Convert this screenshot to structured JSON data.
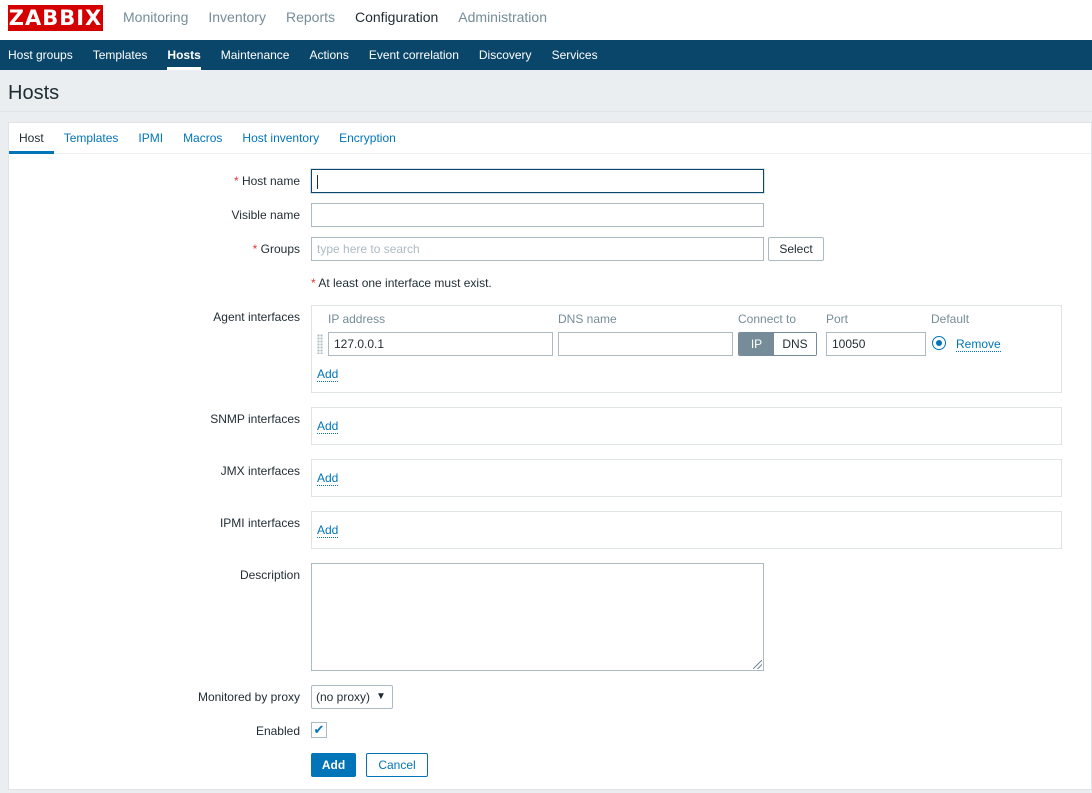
{
  "logo": "ZABBIX",
  "top_menu": [
    "Monitoring",
    "Inventory",
    "Reports",
    "Configuration",
    "Administration"
  ],
  "top_menu_active": "Configuration",
  "sub_menu": [
    "Host groups",
    "Templates",
    "Hosts",
    "Maintenance",
    "Actions",
    "Event correlation",
    "Discovery",
    "Services"
  ],
  "sub_menu_active": "Hosts",
  "page_title": "Hosts",
  "tabs": [
    "Host",
    "Templates",
    "IPMI",
    "Macros",
    "Host inventory",
    "Encryption"
  ],
  "tabs_active": "Host",
  "form": {
    "host_name_label": "Host name",
    "host_name_value": "",
    "visible_name_label": "Visible name",
    "visible_name_value": "",
    "groups_label": "Groups",
    "groups_placeholder": "type here to search",
    "select_button": "Select",
    "interface_warning": "At least one interface must exist.",
    "agent_interfaces_label": "Agent interfaces",
    "iface_headers": {
      "ip": "IP address",
      "dns": "DNS name",
      "connect": "Connect to",
      "port": "Port",
      "default": "Default"
    },
    "agent_interface": {
      "ip": "127.0.0.1",
      "dns": "",
      "connect_options": [
        "IP",
        "DNS"
      ],
      "connect_selected": "IP",
      "port": "10050",
      "remove_label": "Remove"
    },
    "add_link": "Add",
    "snmp_interfaces_label": "SNMP interfaces",
    "jmx_interfaces_label": "JMX interfaces",
    "ipmi_interfaces_label": "IPMI interfaces",
    "description_label": "Description",
    "description_value": "",
    "proxy_label": "Monitored by proxy",
    "proxy_value": "(no proxy)",
    "enabled_label": "Enabled",
    "enabled": true,
    "add_button": "Add",
    "cancel_button": "Cancel"
  },
  "colors": {
    "brand_red": "#d40000",
    "nav_blue": "#0a466a",
    "link_blue": "#0275b8",
    "required_red": "#e33734"
  },
  "icons": {
    "checkbox": "check-icon",
    "select": "chevron-down-icon"
  }
}
